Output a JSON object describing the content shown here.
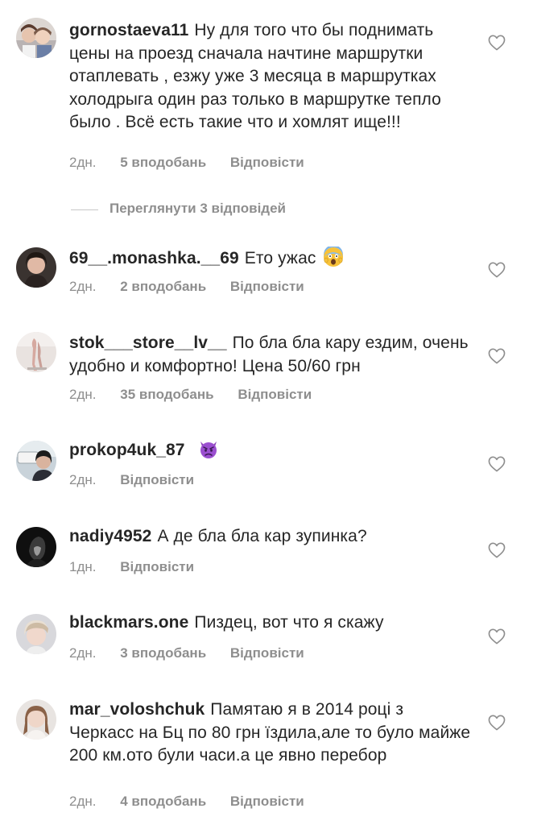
{
  "comments": [
    {
      "username": "gornostaeva11",
      "text": "Ну для того что бы поднимать цены на проезд сначала начтине маршрутки отаплевать , езжу уже 3 месяца в маршрутках холодрыга один раз только в маршрутке тепло было . Всё есть такие что и хомлят ище!!!",
      "time": "2дн.",
      "likes": "5 вподобань",
      "reply": "Відповісти"
    },
    {
      "username": "69__.monashka.__69",
      "text": "Ето ужас",
      "emoji": "scream-emoji",
      "time": "2дн.",
      "likes": "2 вподобань",
      "reply": "Відповісти"
    },
    {
      "username": "stok___store__lv__",
      "text": "По бла бла кару ездим, очень удобно и комфортно! Цена 50/60 грн",
      "time": "2дн.",
      "likes": "35 вподобань",
      "reply": "Відповісти"
    },
    {
      "username": "prokop4uk_87",
      "text": "",
      "emoji": "angry-devil-emoji",
      "time": "2дн.",
      "reply": "Відповісти"
    },
    {
      "username": "nadiy4952",
      "text": "А де бла бла кар зупинка?",
      "time": "1дн.",
      "reply": "Відповісти"
    },
    {
      "username": "blackmars.one",
      "text": "Пиздец, вот что я скажу",
      "time": "2дн.",
      "likes": "3 вподобань",
      "reply": "Відповісти"
    },
    {
      "username": "mar_voloshchuk",
      "text": "Памятаю я в 2014 році з Черкасс на Бц по 80 грн їздила,але то було майже 200 км.ото були часи.а це явно перебор",
      "time": "2дн.",
      "likes": "4 вподобань",
      "reply": "Відповісти"
    }
  ],
  "view_replies": "Переглянути 3 відповідей",
  "colors": {
    "text": "#262626",
    "secondary": "#8e8e8e",
    "divider": "#c7c7c7",
    "background": "#ffffff"
  },
  "icons": {
    "like": "heart-outline-icon"
  }
}
